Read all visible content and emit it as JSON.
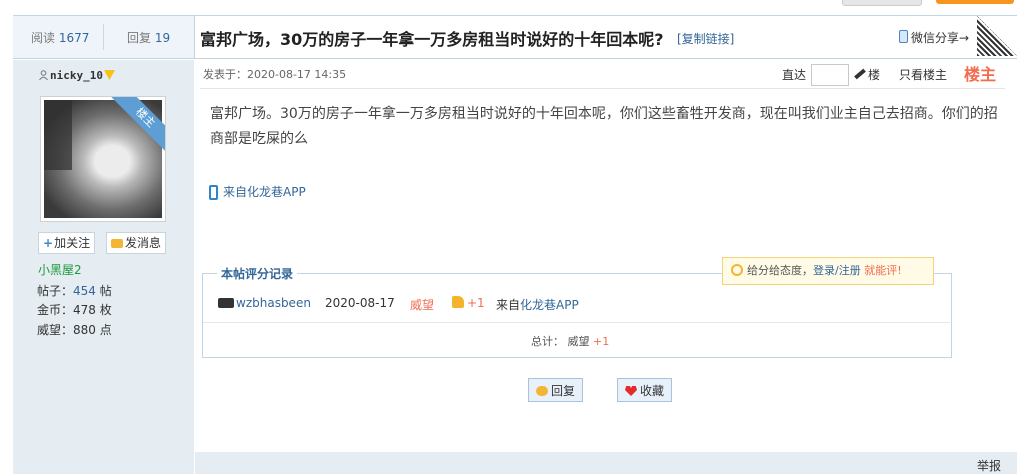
{
  "header": {
    "views_label": "阅读",
    "views": "1677",
    "replies_label": "回复",
    "replies": "19",
    "title": "富邦广场，30万的房子一年拿一万多房租当时说好的十年回本呢?",
    "copy_link": "[复制链接]",
    "share": "微信分享→"
  },
  "author": {
    "username": "nicky_10",
    "badge": "楼主",
    "follow": "加关注",
    "message": "发消息",
    "level": "小黑屋2",
    "stats": [
      {
        "label": "帖子：",
        "value": "454",
        "unit": "帖"
      },
      {
        "label": "金币：",
        "value": "478",
        "unit": "枚"
      },
      {
        "label": "威望：",
        "value": "880",
        "unit": "点"
      }
    ]
  },
  "post": {
    "posted_at": "发表于：2020-08-17 14:35",
    "jump_label": "直达",
    "floor_unit": "楼",
    "only_author": "只看楼主",
    "floor_label": "楼主",
    "content": "富邦广场。30万的房子一年拿一万多房租当时说好的十年回本呢，你们这些畜牲开发商，现在叫我们业主自己去招商。你们的招商部是吃屎的么",
    "from_app": "来自化龙巷APP"
  },
  "rating": {
    "title": "本帖评分记录",
    "tip_prefix": "给分给态度，",
    "tip_link": "登录/注册",
    "tip_suffix": "就能评!",
    "rows": [
      {
        "user": "wzbhasbeen",
        "date": "2020-08-17",
        "type": "威望",
        "score": "+1",
        "reason_prefix": "来自",
        "reason": "化龙巷APP"
      }
    ],
    "total_label": "总计：",
    "total_type": "威望",
    "total_value": "+1"
  },
  "actions": {
    "reply": "回复",
    "favorite": "收藏"
  },
  "report": "举报",
  "colors": {
    "link": "#336699",
    "accent": "#f26c4f",
    "level": "#1c9a3e",
    "header_bg": "#eef4fa",
    "side_bg": "#e5edf2"
  }
}
